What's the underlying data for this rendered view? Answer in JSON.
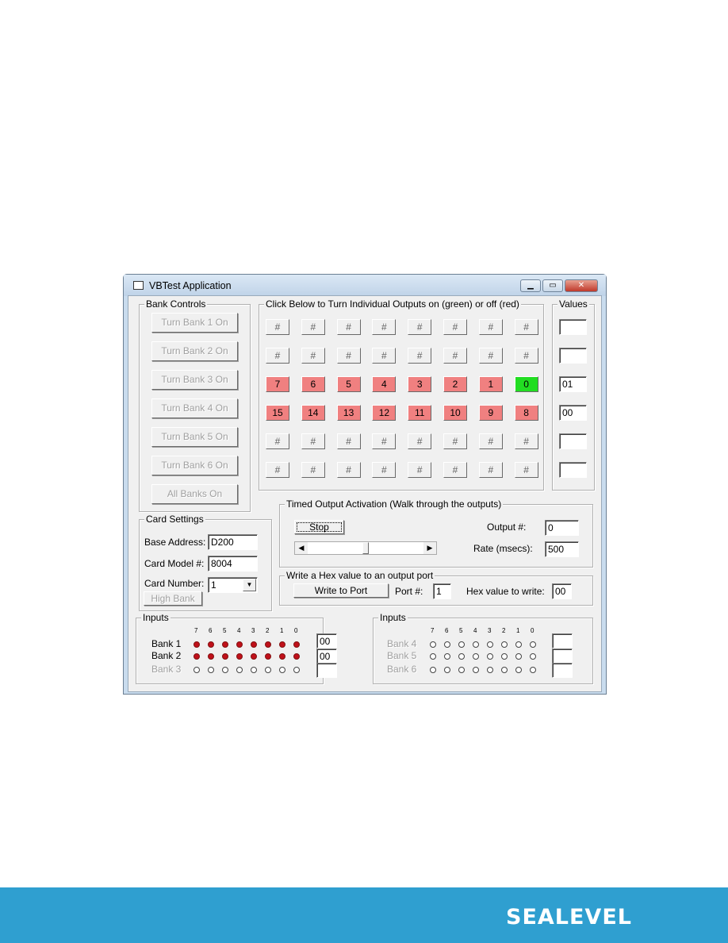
{
  "window": {
    "title": "VBTest Application",
    "icon": "app-window-icon",
    "controls": [
      "minimize-icon",
      "maximize-icon",
      "close-icon"
    ]
  },
  "bank_controls": {
    "label": "Bank Controls",
    "buttons": [
      "Turn Bank 1 On",
      "Turn Bank 2 On",
      "Turn Bank 3 On",
      "Turn Bank 4 On",
      "Turn Bank 5 On",
      "Turn Bank 6 On",
      "All Banks On"
    ]
  },
  "outputs": {
    "label": "Click Below to Turn Individual Outputs on (green) or off (red)",
    "rows": [
      [
        {
          "t": "#",
          "s": "na"
        },
        {
          "t": "#",
          "s": "na"
        },
        {
          "t": "#",
          "s": "na"
        },
        {
          "t": "#",
          "s": "na"
        },
        {
          "t": "#",
          "s": "na"
        },
        {
          "t": "#",
          "s": "na"
        },
        {
          "t": "#",
          "s": "na"
        },
        {
          "t": "#",
          "s": "na"
        }
      ],
      [
        {
          "t": "#",
          "s": "na"
        },
        {
          "t": "#",
          "s": "na"
        },
        {
          "t": "#",
          "s": "na"
        },
        {
          "t": "#",
          "s": "na"
        },
        {
          "t": "#",
          "s": "na"
        },
        {
          "t": "#",
          "s": "na"
        },
        {
          "t": "#",
          "s": "na"
        },
        {
          "t": "#",
          "s": "na"
        }
      ],
      [
        {
          "t": "7",
          "s": "off"
        },
        {
          "t": "6",
          "s": "off"
        },
        {
          "t": "5",
          "s": "off"
        },
        {
          "t": "4",
          "s": "off"
        },
        {
          "t": "3",
          "s": "off"
        },
        {
          "t": "2",
          "s": "off"
        },
        {
          "t": "1",
          "s": "off"
        },
        {
          "t": "0",
          "s": "on"
        }
      ],
      [
        {
          "t": "15",
          "s": "off"
        },
        {
          "t": "14",
          "s": "off"
        },
        {
          "t": "13",
          "s": "off"
        },
        {
          "t": "12",
          "s": "off"
        },
        {
          "t": "11",
          "s": "off"
        },
        {
          "t": "10",
          "s": "off"
        },
        {
          "t": "9",
          "s": "off"
        },
        {
          "t": "8",
          "s": "off"
        }
      ],
      [
        {
          "t": "#",
          "s": "na"
        },
        {
          "t": "#",
          "s": "na"
        },
        {
          "t": "#",
          "s": "na"
        },
        {
          "t": "#",
          "s": "na"
        },
        {
          "t": "#",
          "s": "na"
        },
        {
          "t": "#",
          "s": "na"
        },
        {
          "t": "#",
          "s": "na"
        },
        {
          "t": "#",
          "s": "na"
        }
      ],
      [
        {
          "t": "#",
          "s": "na"
        },
        {
          "t": "#",
          "s": "na"
        },
        {
          "t": "#",
          "s": "na"
        },
        {
          "t": "#",
          "s": "na"
        },
        {
          "t": "#",
          "s": "na"
        },
        {
          "t": "#",
          "s": "na"
        },
        {
          "t": "#",
          "s": "na"
        },
        {
          "t": "#",
          "s": "na"
        }
      ]
    ],
    "colors": {
      "on": "#22dd22",
      "off": "#f08080"
    }
  },
  "values": {
    "label": "Values",
    "fields": [
      "",
      "",
      "01",
      "00",
      "",
      ""
    ]
  },
  "timed": {
    "label": "Timed Output Activation  (Walk through the outputs)",
    "stop_label": "Stop",
    "output_label": "Output #:",
    "output_value": "0",
    "rate_label": "Rate (msecs):",
    "rate_value": "500",
    "slider_fraction": 0.5
  },
  "write_hex": {
    "label": "Write a Hex value to an output port",
    "button": "Write to Port",
    "port_label": "Port #:",
    "port_value": "1",
    "hex_label": "Hex value to write:",
    "hex_value": "00"
  },
  "card": {
    "label": "Card Settings",
    "base_label": "Base Address:",
    "base_value": "D200",
    "model_label": "Card Model #:",
    "model_value": "8004",
    "number_label": "Card Number:",
    "number_value": "1",
    "high_bank": "High Bank"
  },
  "inputs_left": {
    "label": "Inputs",
    "bits": [
      "7",
      "6",
      "5",
      "4",
      "3",
      "2",
      "1",
      "0"
    ],
    "banks": [
      {
        "name": "Bank 1",
        "enabled": true,
        "states": [
          1,
          1,
          1,
          1,
          1,
          1,
          1,
          1
        ],
        "value": "00"
      },
      {
        "name": "Bank 2",
        "enabled": true,
        "states": [
          1,
          1,
          1,
          1,
          1,
          1,
          1,
          1
        ],
        "value": "00"
      },
      {
        "name": "Bank 3",
        "enabled": false,
        "states": [
          0,
          0,
          0,
          0,
          0,
          0,
          0,
          0
        ],
        "value": ""
      }
    ]
  },
  "inputs_right": {
    "label": "Inputs",
    "bits": [
      "7",
      "6",
      "5",
      "4",
      "3",
      "2",
      "1",
      "0"
    ],
    "banks": [
      {
        "name": "Bank 4",
        "enabled": false,
        "states": [
          0,
          0,
          0,
          0,
          0,
          0,
          0,
          0
        ],
        "value": ""
      },
      {
        "name": "Bank 5",
        "enabled": false,
        "states": [
          0,
          0,
          0,
          0,
          0,
          0,
          0,
          0
        ],
        "value": ""
      },
      {
        "name": "Bank 6",
        "enabled": false,
        "states": [
          0,
          0,
          0,
          0,
          0,
          0,
          0,
          0
        ],
        "value": ""
      }
    ]
  },
  "footer": {
    "logo": "SEALEVEL",
    "color": "#2f9fd0"
  }
}
